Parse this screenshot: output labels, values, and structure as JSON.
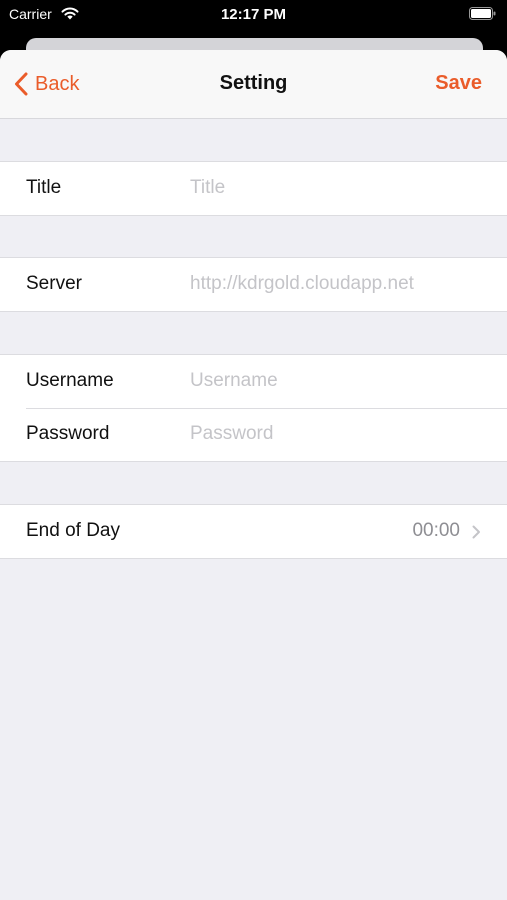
{
  "status_bar": {
    "carrier": "Carrier",
    "time": "12:17 PM",
    "wifi_icon": "wifi-icon",
    "battery_icon": "battery-icon"
  },
  "nav": {
    "back_label": "Back",
    "title": "Setting",
    "save_label": "Save",
    "accent_color": "#ea5c2a"
  },
  "form": {
    "title_row": {
      "label": "Title",
      "value": "",
      "placeholder": "Title"
    },
    "server_row": {
      "label": "Server",
      "value": "",
      "placeholder": "http://kdrgold.cloudapp.net"
    },
    "username_row": {
      "label": "Username",
      "value": "",
      "placeholder": "Username"
    },
    "password_row": {
      "label": "Password",
      "value": "",
      "placeholder": "Password"
    },
    "end_of_day_row": {
      "label": "End of Day",
      "value": "00:00",
      "icon": "chevron-right-icon"
    }
  }
}
